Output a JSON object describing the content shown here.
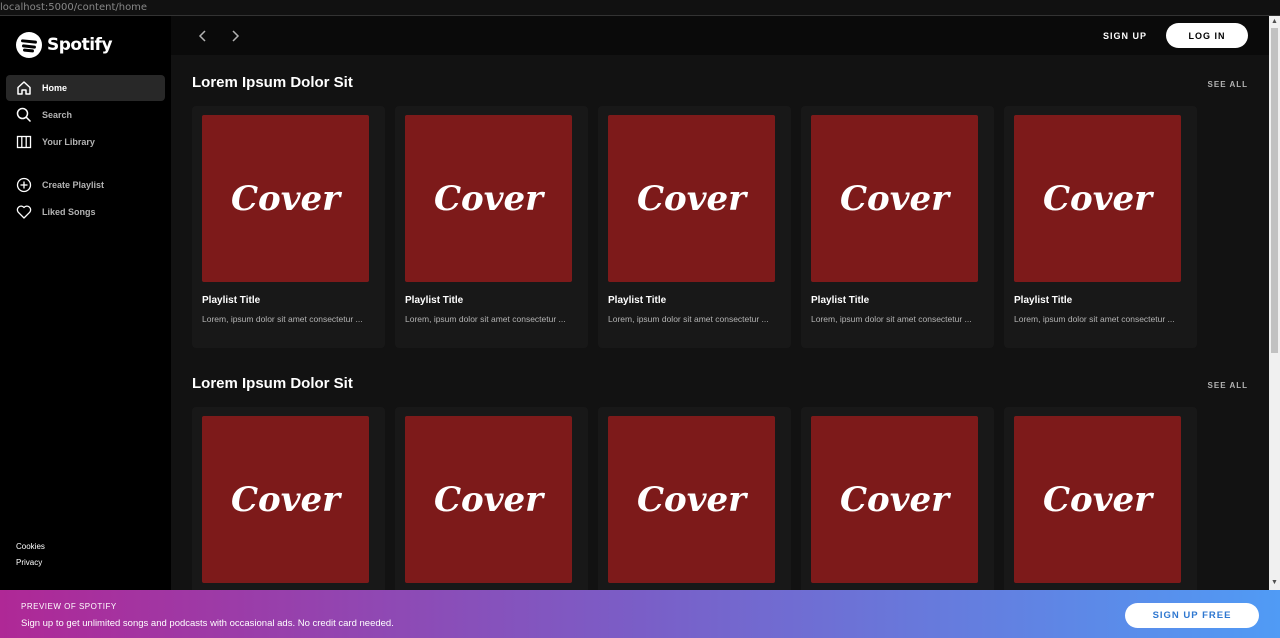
{
  "window": {
    "title": "localhost:5000/content/home"
  },
  "brand": {
    "name": "Spotify",
    "color": "#1db954"
  },
  "sidebar": {
    "items": [
      {
        "label": "Home",
        "icon": "home-icon"
      },
      {
        "label": "Search",
        "icon": "search-icon"
      },
      {
        "label": "Your Library",
        "icon": "library-icon"
      }
    ],
    "actions": [
      {
        "label": "Create Playlist",
        "icon": "plus-circle-icon"
      },
      {
        "label": "Liked Songs",
        "icon": "heart-icon"
      }
    ],
    "footer": [
      "Cookies",
      "Privacy"
    ]
  },
  "topbar": {
    "signup_label": "SIGN UP",
    "login_label": "LOG IN"
  },
  "sections": [
    {
      "title": "Lorem Ipsum Dolor Sit",
      "see_all": "SEE ALL",
      "cards": [
        {
          "cover": "Cover",
          "title": "Playlist Title",
          "desc": "Lorem, ipsum dolor sit amet consectetur ..."
        },
        {
          "cover": "Cover",
          "title": "Playlist Title",
          "desc": "Lorem, ipsum dolor sit amet consectetur ..."
        },
        {
          "cover": "Cover",
          "title": "Playlist Title",
          "desc": "Lorem, ipsum dolor sit amet consectetur ..."
        },
        {
          "cover": "Cover",
          "title": "Playlist Title",
          "desc": "Lorem, ipsum dolor sit amet consectetur ..."
        },
        {
          "cover": "Cover",
          "title": "Playlist Title",
          "desc": "Lorem, ipsum dolor sit amet consectetur ..."
        }
      ]
    },
    {
      "title": "Lorem Ipsum Dolor Sit",
      "see_all": "SEE ALL",
      "cards": [
        {
          "cover": "Cover"
        },
        {
          "cover": "Cover"
        },
        {
          "cover": "Cover"
        },
        {
          "cover": "Cover"
        },
        {
          "cover": "Cover"
        }
      ]
    }
  ],
  "banner": {
    "title": "PREVIEW OF SPOTIFY",
    "text": "Sign up to get unlimited songs and podcasts with occasional ads. No credit card needed.",
    "button": "SIGN UP FREE"
  },
  "colors": {
    "cover": "#7d1a1a",
    "background": "#121212",
    "sidebar": "#000000"
  }
}
